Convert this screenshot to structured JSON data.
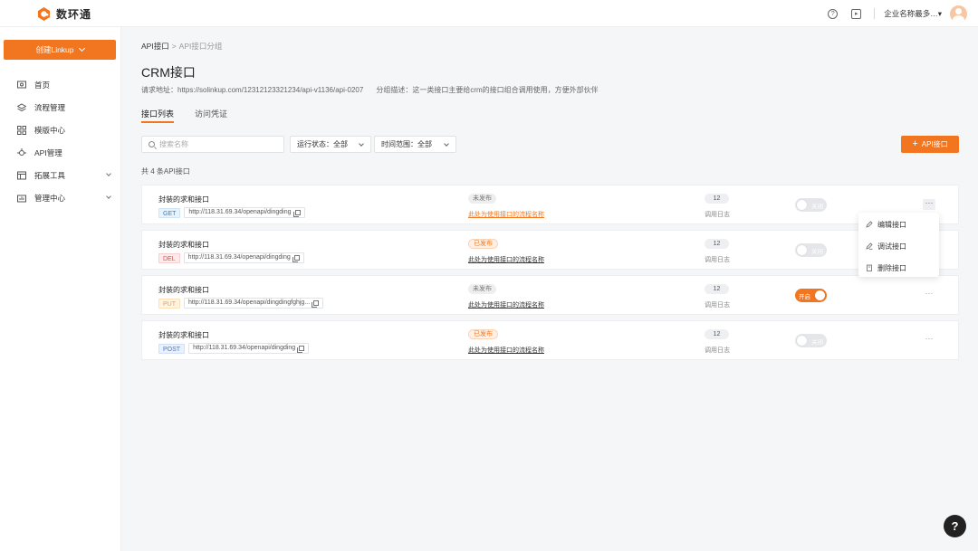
{
  "app": {
    "logo_text": "数环通",
    "brand_color": "#f2751f"
  },
  "topbar": {
    "help_icon": "question-circle-icon",
    "video_icon": "play-box-icon",
    "company": "企业名称最多…▾"
  },
  "sidebar": {
    "create_label": "创建Linkup",
    "items": [
      {
        "label": "首页",
        "icon": "home-icon"
      },
      {
        "label": "流程管理",
        "icon": "layers-icon"
      },
      {
        "label": "模版中心",
        "icon": "grid-icon"
      },
      {
        "label": "API管理",
        "icon": "api-icon"
      },
      {
        "label": "拓展工具",
        "icon": "toolbox-icon"
      },
      {
        "label": "管理中心",
        "icon": "chart-icon"
      }
    ]
  },
  "breadcrumb": {
    "root": "API接口",
    "sep": ">",
    "current": "API接口分组"
  },
  "page": {
    "title": "CRM接口",
    "request_url": "请求地址：https://solinkup.com/12312123321234/api-v1136/api-0207",
    "group_desc": "分组描述：这一类接口主要给crm的接口组合调用使用，方便外部伙伴"
  },
  "tabs": [
    "接口列表",
    "访问凭证"
  ],
  "filters": {
    "search_placeholder": "搜索名称",
    "status_label": "运行状态：全部",
    "time_label": "时间范围：全部",
    "add_label": "API接口"
  },
  "count_text": "共 4 条API接口",
  "rows": [
    {
      "name": "封装的求和接口",
      "method": "GET",
      "url": "http://118.31.69.34/openapi/dingding",
      "status": "未发布",
      "flow": "此处为使用接口的流程名称",
      "count": "12",
      "log": "调用日志",
      "switch": "关闭"
    },
    {
      "name": "封装的求和接口",
      "method": "DEL",
      "url": "http://118.31.69.34/openapi/dingding",
      "status": "已发布",
      "flow": "此处为使用接口的流程名称",
      "count": "12",
      "log": "调用日志",
      "switch": "关闭"
    },
    {
      "name": "封装的求和接口",
      "method": "PUT",
      "url": "http://118.31.69.34/openapi/dingdingfghjg...",
      "status": "未发布",
      "flow": "此处为使用接口的流程名称",
      "count": "12",
      "log": "调用日志",
      "switch": "开启"
    },
    {
      "name": "封装的求和接口",
      "method": "POST",
      "url": "http://118.31.69.34/openapi/dingding",
      "status": "已发布",
      "flow": "此处为使用接口的流程名称",
      "count": "12",
      "log": "调用日志",
      "switch": "关闭"
    }
  ],
  "more_label": "···",
  "menu": [
    {
      "label": "编辑接口",
      "icon": "edit-icon"
    },
    {
      "label": "调试接口",
      "icon": "debug-icon"
    },
    {
      "label": "删除接口",
      "icon": "delete-icon"
    }
  ],
  "help_label": "?"
}
